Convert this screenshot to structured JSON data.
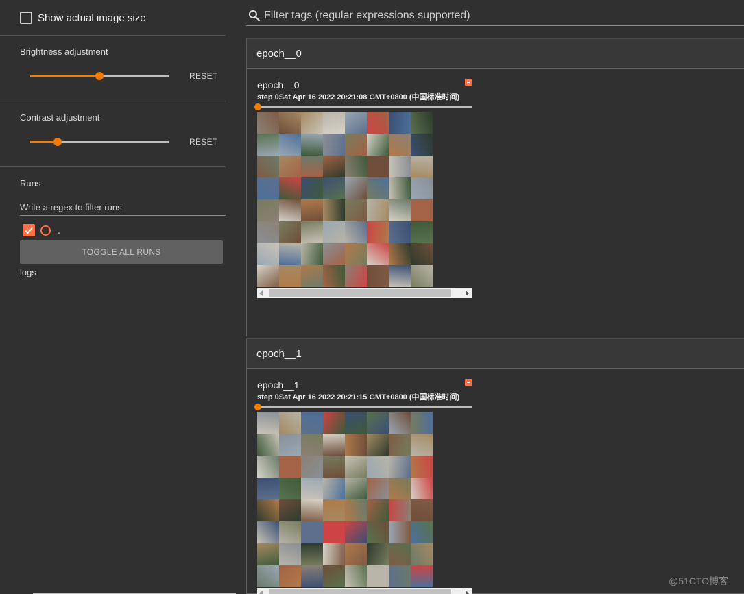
{
  "sidebar": {
    "show_actual_size_label": "Show actual image size",
    "brightness": {
      "title": "Brightness adjustment",
      "reset_label": "RESET",
      "value": 0.5
    },
    "contrast": {
      "title": "Contrast adjustment",
      "reset_label": "RESET",
      "value": 0.2
    },
    "runs": {
      "title": "Runs",
      "filter_placeholder": "Write a regex to filter runs",
      "run_label": ".",
      "run_checked": true,
      "toggle_all_label": "TOGGLE ALL RUNS",
      "run_name": "logs"
    }
  },
  "search": {
    "placeholder": "Filter tags (regular expressions supported)"
  },
  "groups": [
    {
      "header": "epoch__0",
      "card": {
        "title": "epoch__0",
        "step_label": "step 0",
        "timestamp": "Sat Apr 16 2022 20:21:08 GMT+0800 (中国标准时间)"
      }
    },
    {
      "header": "epoch__1",
      "card": {
        "title": "epoch__1",
        "step_label": "step 0",
        "timestamp": "Sat Apr 16 2022 20:21:15 GMT+0800 (中国标准时间)"
      }
    }
  ],
  "colors": {
    "accent": "#f57c00",
    "run_color": "#ff7043",
    "background": "#303030"
  },
  "watermark": "@51CTO博客"
}
